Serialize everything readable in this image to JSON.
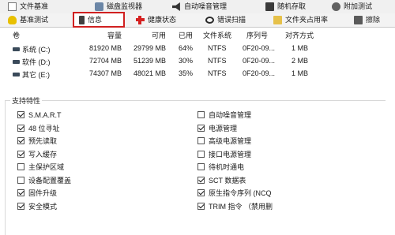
{
  "tabs_row1": [
    {
      "label": "文件基准",
      "icon": "document-icon"
    },
    {
      "label": "磁盘监视器",
      "icon": "disk-icon"
    },
    {
      "label": "自动噪音管理",
      "icon": "speaker-icon"
    },
    {
      "label": "随机存取",
      "icon": "calculator-icon"
    },
    {
      "label": "附加测试",
      "icon": "gear-icon"
    }
  ],
  "tabs_row2": [
    {
      "label": "基准测试",
      "icon": "lightbulb-icon"
    },
    {
      "label": "信息",
      "icon": "battery-icon",
      "selected": true
    },
    {
      "label": "健康状态",
      "icon": "health-cross-icon"
    },
    {
      "label": "错误扫描",
      "icon": "search-icon"
    },
    {
      "label": "文件夹占用率",
      "icon": "folder-icon"
    },
    {
      "label": "擦除",
      "icon": "trash-icon"
    }
  ],
  "partition_table": {
    "columns": [
      "卷",
      "容量",
      "可用",
      "已用",
      "文件系统",
      "序列号",
      "对齐方式"
    ],
    "rows": [
      {
        "volume": "系统 (C:)",
        "capacity": "81920 MB",
        "free": "29799 MB",
        "used": "64%",
        "fs": "NTFS",
        "serial": "0F20-09...",
        "align": "1 MB"
      },
      {
        "volume": "软件 (D:)",
        "capacity": "72704 MB",
        "free": "51239 MB",
        "used": "30%",
        "fs": "NTFS",
        "serial": "0F20-09...",
        "align": "2 MB"
      },
      {
        "volume": "其它 (E:)",
        "capacity": "74307 MB",
        "free": "48021 MB",
        "used": "35%",
        "fs": "NTFS",
        "serial": "0F20-09...",
        "align": "1 MB"
      }
    ]
  },
  "features": {
    "title": "支持特性",
    "left": [
      {
        "label": "S.M.A.R.T",
        "checked": true
      },
      {
        "label": "48 位寻址",
        "checked": true
      },
      {
        "label": "预先读取",
        "checked": true
      },
      {
        "label": "写入缓存",
        "checked": true
      },
      {
        "label": "主保护区域",
        "checked": false
      },
      {
        "label": "设备配置覆盖",
        "checked": false
      },
      {
        "label": "固件升级",
        "checked": true
      },
      {
        "label": "安全模式",
        "checked": true
      }
    ],
    "right": [
      {
        "label": "自动噪音管理",
        "checked": false
      },
      {
        "label": "电源管理",
        "checked": true
      },
      {
        "label": "高级电源管理",
        "checked": false
      },
      {
        "label": "接口电源管理",
        "checked": false
      },
      {
        "label": "待机时通电",
        "checked": false
      },
      {
        "label": "SCT 数据表",
        "checked": true
      },
      {
        "label": "原生指令序列 (NCQ",
        "checked": true
      },
      {
        "label": "TRIM 指令 （禁用删",
        "checked": true
      }
    ]
  }
}
